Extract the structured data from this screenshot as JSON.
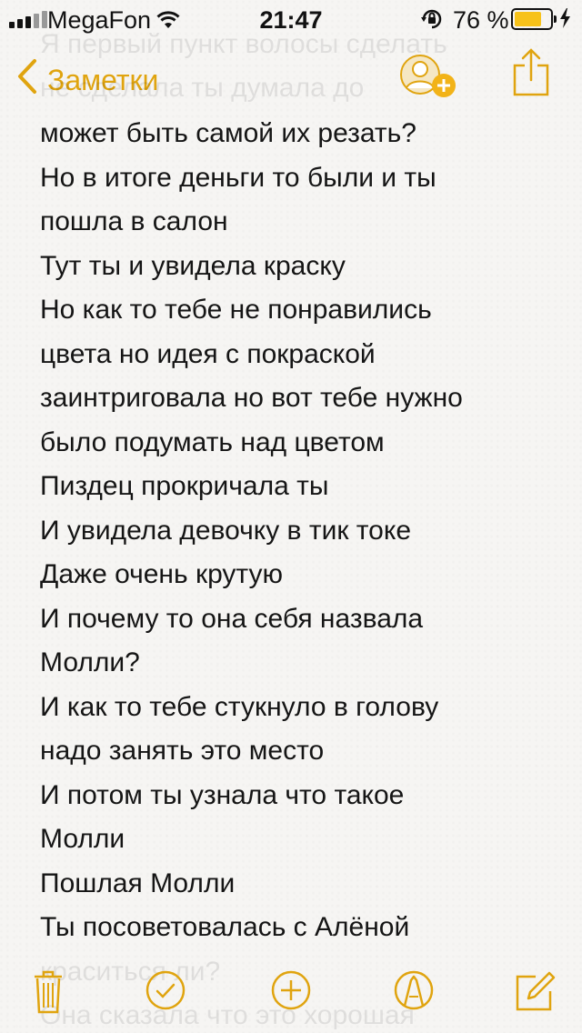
{
  "status_bar": {
    "carrier": "MegaFon",
    "time": "21:47",
    "battery_percent": "76 %",
    "battery_level": 0.76,
    "icons": [
      "signal-icon",
      "wifi-icon",
      "orientation-lock-icon",
      "battery-icon",
      "charging-icon"
    ]
  },
  "nav": {
    "back_label": "Заметки",
    "icons": [
      "chevron-left-icon",
      "add-person-icon",
      "share-icon"
    ],
    "accent_color": "#e0a40f"
  },
  "note": {
    "ghost_top": [
      "Я первый пункт волосы сделать",
      "не сделала ты думала до"
    ],
    "lines": [
      "может быть самой их резать?",
      "Но в итоге деньги то были и ты",
      "пошла в салон",
      "Тут ты и увидела краску",
      "Но как то тебе не понравились",
      "цвета но идея с покраской",
      "заинтриговала но вот тебе нужно",
      "было подумать над цветом",
      "Пиздец прокричала ты",
      "И увидела девочку в тик токе",
      "Даже очень крутую",
      "И почему то она себя назвала",
      "Молли?",
      "И как то тебе стукнуло в голову",
      "надо занять это место",
      "И потом ты узнала что такое",
      "Молли",
      "Пошлая Молли",
      "Ты посоветовалась с Алёной"
    ],
    "ghost_bottom": [
      "краситься ли?",
      "Она сказала что это хорошая"
    ]
  },
  "toolbar": {
    "icons": [
      "trash-icon",
      "checklist-icon",
      "add-icon",
      "markup-pen-icon",
      "compose-icon"
    ]
  }
}
